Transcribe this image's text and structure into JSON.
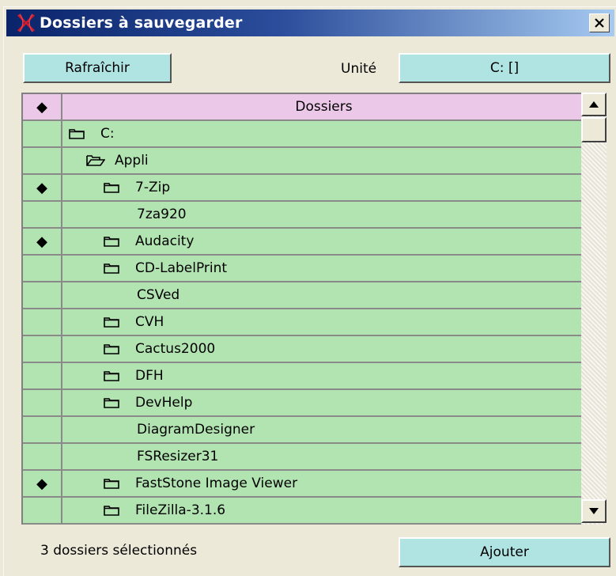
{
  "window": {
    "title": "Dossiers à sauvegarder",
    "close_label": "✕"
  },
  "toolbar": {
    "refresh_label": "Rafraîchir",
    "unit_label": "Unité",
    "unit_value": "C: []"
  },
  "grid": {
    "mark_header": "◆",
    "name_header": "Dossiers",
    "rows": [
      {
        "marked": false,
        "indent": 0,
        "icon": "folder-closed-icon",
        "name": "C:"
      },
      {
        "marked": false,
        "indent": 1,
        "icon": "folder-open-icon",
        "name": "Appli"
      },
      {
        "marked": true,
        "indent": 2,
        "icon": "folder-closed-icon",
        "name": "7-Zip"
      },
      {
        "marked": false,
        "indent": 2,
        "icon": "none",
        "name": "7za920"
      },
      {
        "marked": true,
        "indent": 2,
        "icon": "folder-closed-icon",
        "name": "Audacity"
      },
      {
        "marked": false,
        "indent": 2,
        "icon": "folder-closed-icon",
        "name": "CD-LabelPrint"
      },
      {
        "marked": false,
        "indent": 2,
        "icon": "none",
        "name": "CSVed"
      },
      {
        "marked": false,
        "indent": 2,
        "icon": "folder-closed-icon",
        "name": "CVH"
      },
      {
        "marked": false,
        "indent": 2,
        "icon": "folder-closed-icon",
        "name": "Cactus2000"
      },
      {
        "marked": false,
        "indent": 2,
        "icon": "folder-closed-icon",
        "name": "DFH"
      },
      {
        "marked": false,
        "indent": 2,
        "icon": "folder-closed-icon",
        "name": "DevHelp"
      },
      {
        "marked": false,
        "indent": 2,
        "icon": "none",
        "name": "DiagramDesigner"
      },
      {
        "marked": false,
        "indent": 2,
        "icon": "none",
        "name": "FSResizer31"
      },
      {
        "marked": true,
        "indent": 2,
        "icon": "folder-closed-icon",
        "name": "FastStone Image Viewer"
      },
      {
        "marked": false,
        "indent": 2,
        "icon": "folder-closed-icon",
        "name": "FileZilla-3.1.6"
      },
      {
        "marked": false,
        "indent": 2,
        "icon": "folder-closed-icon",
        "name": ""
      }
    ],
    "mark_symbol": "◆"
  },
  "footer": {
    "status_text": "3 dossiers sélectionnés",
    "add_label": "Ajouter"
  },
  "colors": {
    "header_bg": "#ecc8e8",
    "row_bg": "#b2e4b2",
    "button_bg": "#b0e4e2",
    "titlebar_start": "#0a246a",
    "titlebar_end": "#a6caf0"
  }
}
